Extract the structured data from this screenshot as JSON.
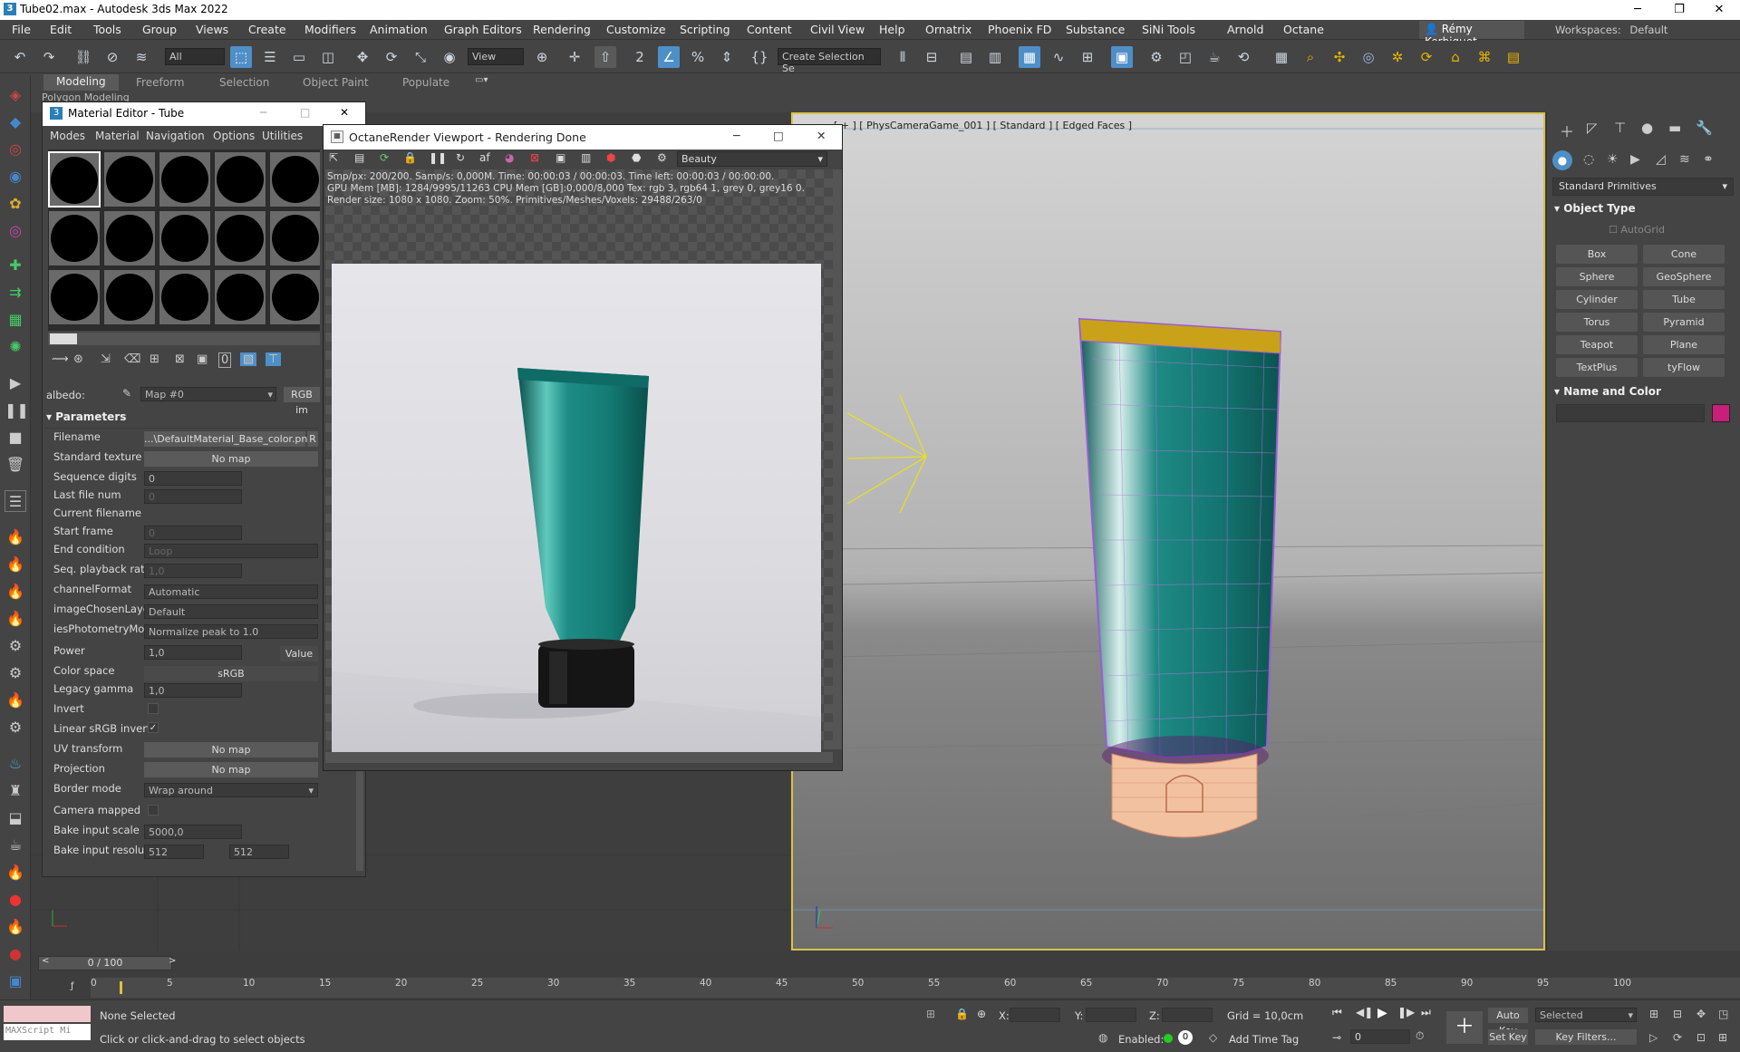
{
  "window": {
    "title": "Tube02.max - Autodesk 3ds Max 2022"
  },
  "menu": [
    "File",
    "Edit",
    "Tools",
    "Group",
    "Views",
    "Create",
    "Modifiers",
    "Animation",
    "Graph Editors",
    "Rendering",
    "Customize",
    "Scripting",
    "Content",
    "Civil View",
    "Help",
    "Ornatrix",
    "Phoenix FD",
    "Substance",
    "SiNi Tools",
    "Arnold",
    "Octane"
  ],
  "user": "Rémy Kerbiquet",
  "workspace": {
    "label": "Workspaces:",
    "value": "Default"
  },
  "toolbar": {
    "filter": "All",
    "view": "View",
    "selection_set": "Create Selection Se"
  },
  "ribbon": {
    "tabs": [
      "Modeling",
      "Freeform",
      "Selection",
      "Object Paint",
      "Populate"
    ],
    "sub": "Polygon Modeling"
  },
  "material_editor": {
    "title": "Material Editor - Tube",
    "menu": [
      "Modes",
      "Material",
      "Navigation",
      "Options",
      "Utilities"
    ],
    "slot_label": "albedo:",
    "map_name": "Map #0",
    "map_type": "RGB im",
    "section": "Parameters",
    "params": [
      {
        "label": "Filename",
        "value": "...\\DefaultMaterial_Base_color.png",
        "extra": "R"
      },
      {
        "label": "Standard texture",
        "value": "No map"
      },
      {
        "label": "Sequence digits",
        "value": "0"
      },
      {
        "label": "Last file num",
        "value": "0"
      },
      {
        "label": "Current filename",
        "value": ""
      },
      {
        "label": "Start frame",
        "value": "0"
      },
      {
        "label": "End condition",
        "value": "Loop"
      },
      {
        "label": "Seq. playback rate",
        "value": "1,0"
      },
      {
        "label": "channelFormat",
        "value": "Automatic"
      },
      {
        "label": "imageChosenLaye...",
        "value": "Default"
      },
      {
        "label": "iesPhotometryMode",
        "value": "Normalize peak to 1.0"
      },
      {
        "label": "Power",
        "value": "1,0",
        "extra": "Value"
      },
      {
        "label": "Color space",
        "value": "sRGB"
      },
      {
        "label": "Legacy gamma",
        "value": "1,0"
      },
      {
        "label": "Invert",
        "value": ""
      },
      {
        "label": "Linear sRGB invert",
        "value": "✓"
      },
      {
        "label": "UV transform",
        "value": "No map"
      },
      {
        "label": "Projection",
        "value": "No map"
      },
      {
        "label": "Border mode",
        "value": "Wrap around"
      },
      {
        "label": "Camera mapped",
        "value": ""
      },
      {
        "label": "Bake input scale",
        "value": "5000,0"
      },
      {
        "label": "Bake input resolution",
        "value": "512",
        "extra": "512"
      }
    ]
  },
  "octane": {
    "title": "OctaneRender Viewport - Rendering Done",
    "pass": "Beauty",
    "info": [
      "Smp/px: 200/200.   Samp/s: 0,000M.   Time: 00:00:03 / 00:00:03.   Time left: 00:00:03 / 00:00:00.",
      "GPU Mem [MB]: 1284/9995/11263   CPU Mem [GB]:0,000/8,000   Tex: rgb 3, rgb64 1, grey 0, grey16 0.",
      "Render size: 1080 x 1080.   Zoom: 50%.   Primitives/Meshes/Voxels: 29488/263/0"
    ]
  },
  "viewport": {
    "label": "[ + ] [ PhysCameraGame_001 ] [ Standard ] [ Edged Faces ]"
  },
  "command_panel": {
    "dropdown": "Standard Primitives",
    "object_type": "Object Type",
    "autogrid": "AutoGrid",
    "buttons": [
      "Box",
      "Cone",
      "Sphere",
      "GeoSphere",
      "Cylinder",
      "Tube",
      "Torus",
      "Pyramid",
      "Teapot",
      "Plane",
      "TextPlus",
      "tyFlow"
    ],
    "name_color": "Name and Color",
    "swatch": "#c8207a"
  },
  "timeline": {
    "frame": "0 / 100",
    "ticks": [
      "0",
      "5",
      "10",
      "15",
      "20",
      "25",
      "30",
      "35",
      "40",
      "45",
      "50",
      "55",
      "60",
      "65",
      "70",
      "75",
      "80",
      "85",
      "90",
      "95",
      "100"
    ]
  },
  "status": {
    "maxscript": "MAXScript Mi",
    "selected": "None Selected",
    "prompt": "Click or click-and-drag to select objects",
    "x": "X:",
    "y": "Y:",
    "z": "Z:",
    "grid": "Grid = 10,0cm",
    "enabled": "Enabled:",
    "enabled_val": "0",
    "add_time_tag": "Add Time Tag",
    "auto_key": "Auto Key",
    "set_key": "Set Key",
    "selected_dd": "Selected",
    "key_filters": "Key Filters...",
    "frame_field": "0"
  },
  "colors": {
    "accent": "#4f8fc8",
    "teal": "#1a8a84",
    "viewport_border": "#d8c24a"
  }
}
